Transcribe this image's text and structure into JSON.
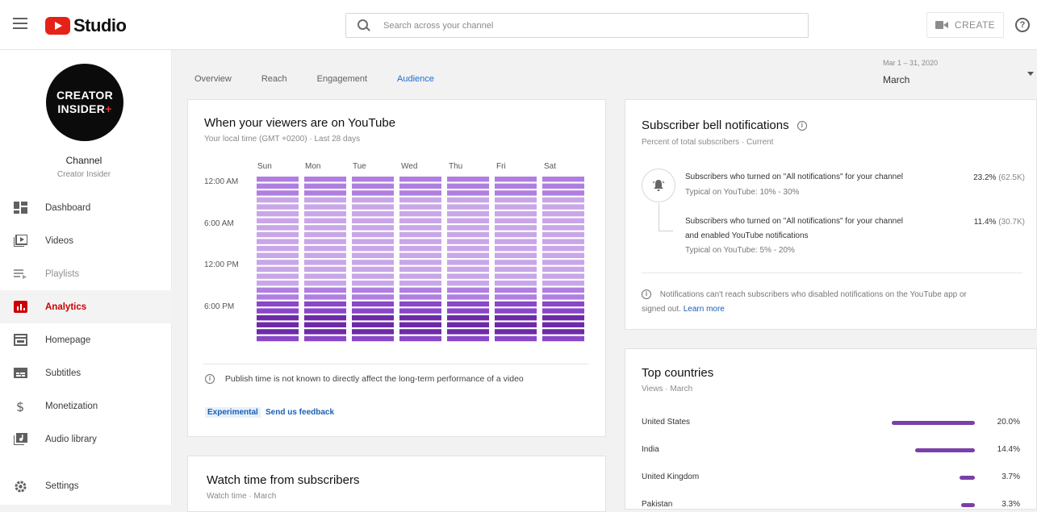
{
  "app": {
    "logo_text": "Studio"
  },
  "search": {
    "placeholder": "Search across your channel"
  },
  "header": {
    "create_label": "CREATE",
    "help_glyph": "?"
  },
  "channel": {
    "avatar_line1": "CREATOR",
    "avatar_line2": "INSIDER",
    "avatar_plus": "+",
    "title": "Channel",
    "name": "Creator Insider"
  },
  "sidebar": {
    "items": [
      {
        "label": "Dashboard",
        "icon": "dashboard-icon"
      },
      {
        "label": "Videos",
        "icon": "videos-icon"
      },
      {
        "label": "Playlists",
        "icon": "playlists-icon"
      },
      {
        "label": "Analytics",
        "icon": "analytics-icon"
      },
      {
        "label": "Homepage",
        "icon": "homepage-icon"
      },
      {
        "label": "Subtitles",
        "icon": "subtitles-icon"
      },
      {
        "label": "Monetization",
        "icon": "monetization-icon"
      },
      {
        "label": "Audio library",
        "icon": "audio-library-icon"
      }
    ],
    "settings_label": "Settings"
  },
  "tabs": [
    "Overview",
    "Reach",
    "Engagement",
    "Audience"
  ],
  "active_tab": "Audience",
  "date_range": {
    "range": "Mar 1 – 31, 2020",
    "label": "March"
  },
  "viewers_card": {
    "title": "When your viewers are on YouTube",
    "subtitle": "Your local time (GMT +0200) · Last 28 days",
    "days": [
      "Sun",
      "Mon",
      "Tue",
      "Wed",
      "Thu",
      "Fri",
      "Sat"
    ],
    "time_labels": [
      "12:00 AM",
      "6:00 AM",
      "12:00 PM",
      "6:00 PM"
    ],
    "note": "Publish time is not known to directly affect the long-term performance of a video",
    "experimental_label": "Experimental",
    "feedback_label": "Send us feedback",
    "colors": {
      "low": "#c9a6e8",
      "mid": "#b07ee0",
      "high": "#8a47c8",
      "peak": "#6e2aa8"
    }
  },
  "bell_card": {
    "title": "Subscriber bell notifications",
    "subtitle": "Percent of total subscribers · Current",
    "row1_text": "Subscribers who turned on \"All notifications\" for your channel",
    "row1_typical": "Typical on YouTube: 10% - 30%",
    "row1_pct": "23.2%",
    "row1_count": "(62.5K)",
    "row2_text_line1": "Subscribers who turned on \"All notifications\" for your channel",
    "row2_text_line2": "and enabled YouTube notifications",
    "row2_typical": "Typical on YouTube: 5% - 20%",
    "row2_pct": "11.4%",
    "row2_count": "(30.7K)",
    "footer_line1": "Notifications can't reach subscribers who disabled notifications on the YouTube app or",
    "footer_line2": "signed out.",
    "learn_more": "Learn more"
  },
  "countries_card": {
    "title": "Top countries",
    "subtitle": "Views · March",
    "items": [
      {
        "name": "United States",
        "pct": "20.0%",
        "value": 20.0
      },
      {
        "name": "India",
        "pct": "14.4%",
        "value": 14.4
      },
      {
        "name": "United Kingdom",
        "pct": "3.7%",
        "value": 3.7
      },
      {
        "name": "Pakistan",
        "pct": "3.3%",
        "value": 3.3
      }
    ],
    "bar_color": "#7b3fa8"
  },
  "subs_card": {
    "title": "Watch time from subscribers",
    "subtitle": "Watch time · March"
  }
}
